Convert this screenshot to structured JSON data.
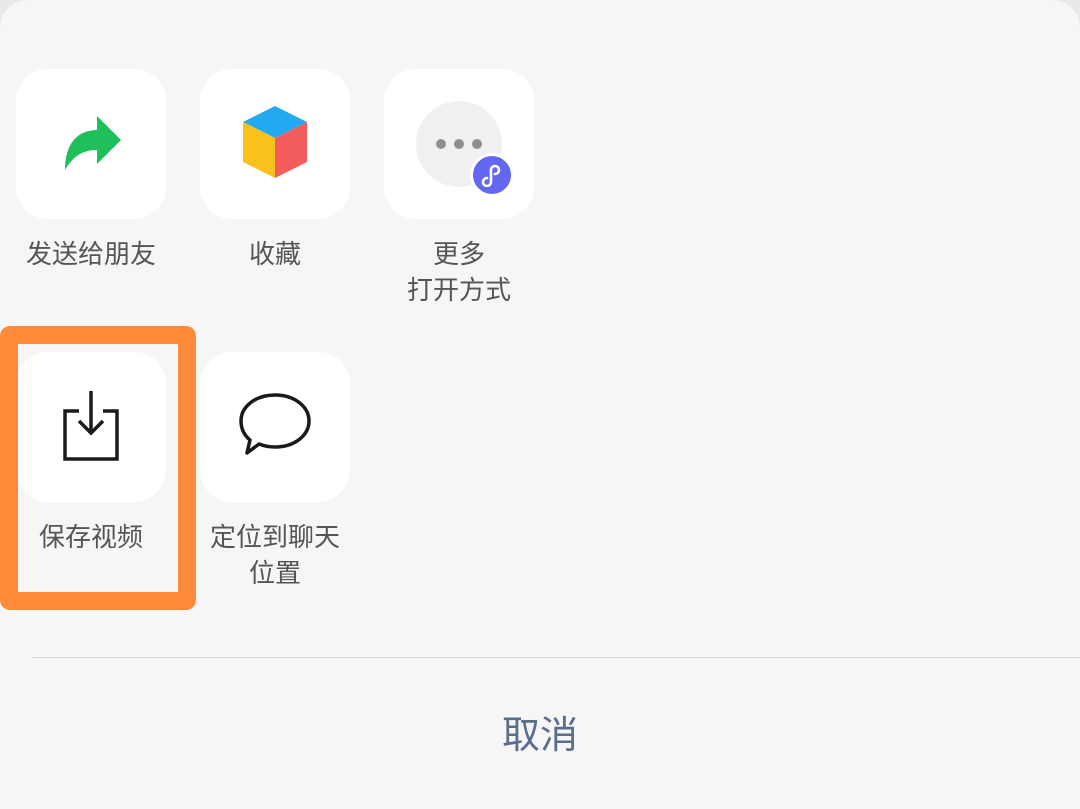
{
  "share_sheet": {
    "row1": [
      {
        "label_lines": [
          "发送给朋友"
        ],
        "icon": "forward-arrow-icon",
        "color": "#1fbf5c"
      },
      {
        "label_lines": [
          "收藏"
        ],
        "icon": "favorites-cube-icon"
      },
      {
        "label_lines": [
          "更多",
          "打开方式"
        ],
        "icon": "more-dots-icon",
        "badge_icon": "mini-program-icon",
        "badge_color": "#6467f0"
      }
    ],
    "row2": [
      {
        "label_lines": [
          "保存视频"
        ],
        "icon": "download-tray-icon",
        "highlighted": true,
        "highlight_color": "#ff8a3a"
      },
      {
        "label_lines": [
          "定位到聊天",
          "位置"
        ],
        "icon": "chat-bubble-icon"
      }
    ]
  },
  "cancel": {
    "label": "取消",
    "color": "#5b6d8c"
  }
}
